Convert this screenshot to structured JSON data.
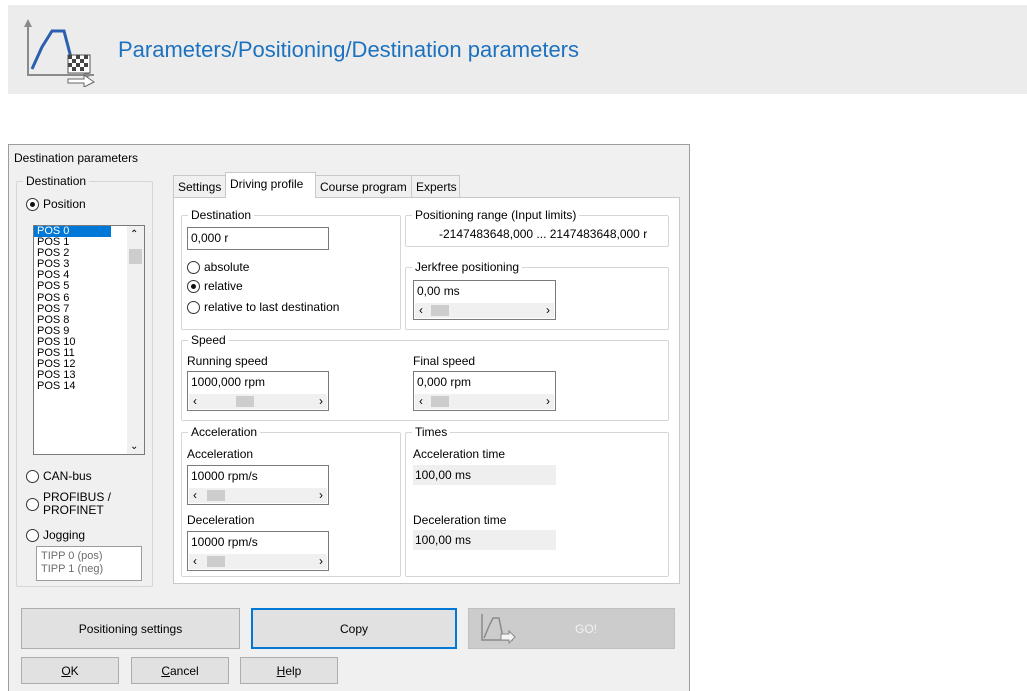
{
  "banner": {
    "title": "Parameters/Positioning/Destination parameters",
    "icon": "positioning-icon",
    "title_color": "#1d72c0"
  },
  "dialog": {
    "title": "Destination parameters",
    "left": {
      "group_caption": "Destination",
      "position_label": "Position",
      "positions": [
        "POS 0",
        "POS 1",
        "POS 2",
        "POS 3",
        "POS 4",
        "POS 5",
        "POS 6",
        "POS 7",
        "POS 8",
        "POS 9",
        "POS 10",
        "POS 11",
        "POS 12",
        "POS 13",
        "POS 14"
      ],
      "selected_position": "POS 0",
      "canbus_label": "CAN-bus",
      "profibus_label_1": "PROFIBUS /",
      "profibus_label_2": "PROFINET",
      "jogging_label": "Jogging",
      "tipp": [
        "TIPP 0 (pos)",
        "TIPP 1 (neg)"
      ]
    },
    "tabs": [
      {
        "label": "Settings",
        "active": false
      },
      {
        "label": "Driving profile",
        "active": true
      },
      {
        "label": "Course program",
        "active": false
      },
      {
        "label": "Experts",
        "active": false
      }
    ],
    "destination": {
      "caption": "Destination",
      "value": "0,000 r",
      "options": [
        "absolute",
        "relative",
        "relative to last destination"
      ],
      "selected": "relative"
    },
    "positioning_range": {
      "caption": "Positioning range (Input limits)",
      "value": "-2147483648,000 ... 2147483648,000  r"
    },
    "jerkfree": {
      "caption": "Jerkfree positioning",
      "value": "0,00 ms"
    },
    "speed": {
      "caption": "Speed",
      "running_label": "Running speed",
      "running_value": "1000,000 rpm",
      "final_label": "Final speed",
      "final_value": "0,000 rpm"
    },
    "acceleration": {
      "caption": "Acceleration",
      "acc_label": "Acceleration",
      "acc_value": "10000 rpm/s",
      "dec_label": "Deceleration",
      "dec_value": "10000 rpm/s"
    },
    "times": {
      "caption": "Times",
      "acc_time_label": "Acceleration time",
      "acc_time_value": "100,00 ms",
      "dec_time_label": "Deceleration time",
      "dec_time_value": "100,00 ms"
    },
    "buttons": {
      "positioning_settings": "Positioning settings",
      "copy": "Copy",
      "go": "GO!",
      "ok": "OK",
      "cancel": "Cancel",
      "help": "Help"
    }
  }
}
